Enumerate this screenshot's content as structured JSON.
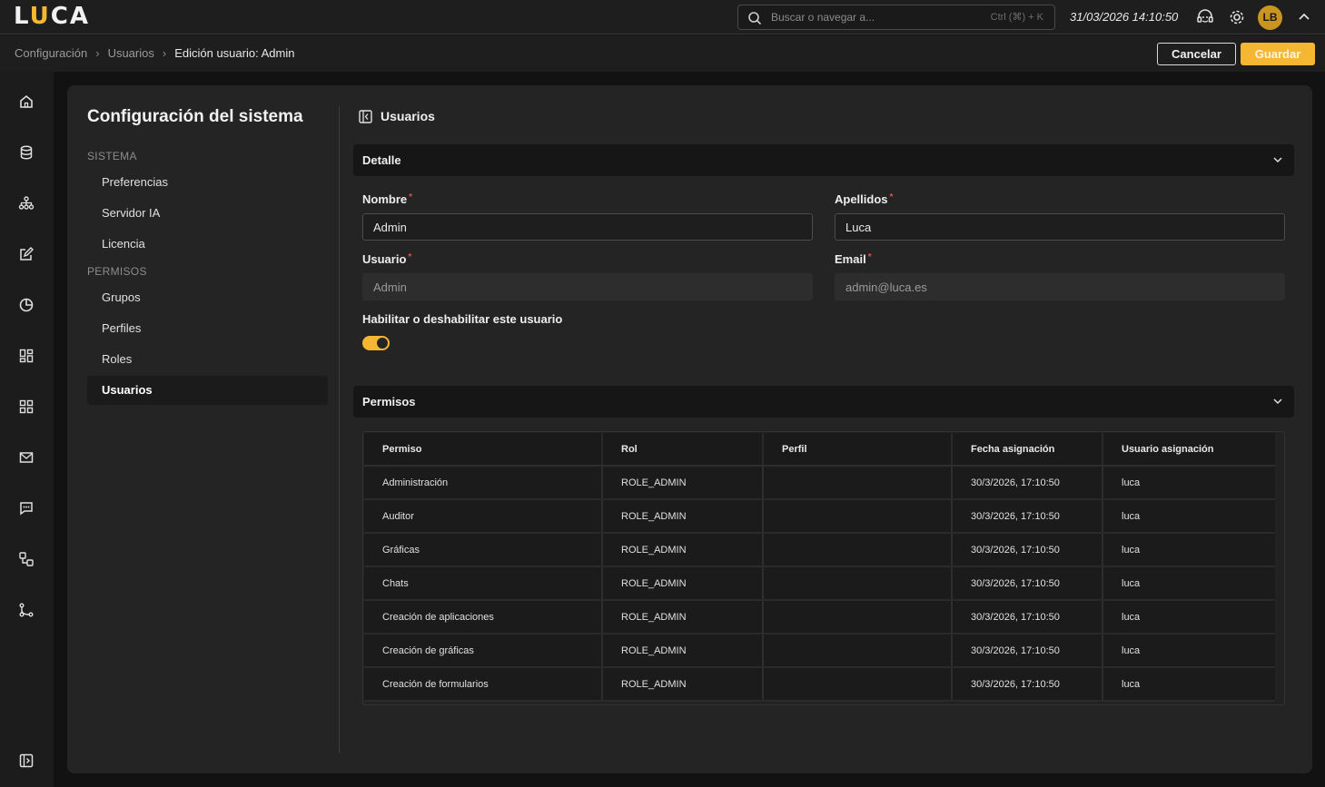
{
  "app": {
    "logo": "LUCA",
    "search_placeholder": "Buscar o navegar a...",
    "search_shortcut": "Ctrl (⌘) + K",
    "datetime": "31/03/2026 14:10:50",
    "avatar_initials": "LB",
    "accent_color": "#f5b731"
  },
  "breadcrumb": {
    "items": [
      "Configuración",
      "Usuarios"
    ],
    "current": "Edición usuario: Admin"
  },
  "actions": {
    "cancel": "Cancelar",
    "save": "Guardar"
  },
  "rail_icons": [
    "home-icon",
    "database-icon",
    "network-icon",
    "edit-icon",
    "pie-chart-icon",
    "dashboard-icon",
    "apps-grid-icon",
    "mail-icon",
    "chat-icon",
    "flow-icon",
    "branch-icon",
    "sidebar-toggle-icon"
  ],
  "config_nav": {
    "title": "Configuración del sistema",
    "sections": [
      {
        "label": "SISTEMA",
        "items": [
          "Preferencias",
          "Servidor IA",
          "Licencia"
        ]
      },
      {
        "label": "PERMISOS",
        "items": [
          "Grupos",
          "Perfiles",
          "Roles",
          "Usuarios"
        ]
      }
    ],
    "active_item": "Usuarios"
  },
  "content": {
    "title": "Usuarios",
    "detail_section": "Detalle",
    "fields": {
      "nombre": {
        "label": "Nombre",
        "value": "Admin"
      },
      "apellidos": {
        "label": "Apellidos",
        "value": "Luca"
      },
      "usuario": {
        "label": "Usuario",
        "value": "Admin"
      },
      "email": {
        "label": "Email",
        "value": "admin@luca.es"
      }
    },
    "required_mark": "*",
    "enable_label": "Habilitar o deshabilitar este usuario",
    "enabled": true,
    "permissions_section": "Permisos"
  },
  "permissions_table": {
    "columns": [
      "Permiso",
      "Rol",
      "Perfil",
      "Fecha asignación",
      "Usuario asignación"
    ],
    "rows": [
      [
        "Administración",
        "ROLE_ADMIN",
        "",
        "30/3/2026, 17:10:50",
        "luca"
      ],
      [
        "Auditor",
        "ROLE_ADMIN",
        "",
        "30/3/2026, 17:10:50",
        "luca"
      ],
      [
        "Gráficas",
        "ROLE_ADMIN",
        "",
        "30/3/2026, 17:10:50",
        "luca"
      ],
      [
        "Chats",
        "ROLE_ADMIN",
        "",
        "30/3/2026, 17:10:50",
        "luca"
      ],
      [
        "Creación de aplicaciones",
        "ROLE_ADMIN",
        "",
        "30/3/2026, 17:10:50",
        "luca"
      ],
      [
        "Creación de gráficas",
        "ROLE_ADMIN",
        "",
        "30/3/2026, 17:10:50",
        "luca"
      ],
      [
        "Creación de formularios",
        "ROLE_ADMIN",
        "",
        "30/3/2026, 17:10:50",
        "luca"
      ]
    ]
  }
}
